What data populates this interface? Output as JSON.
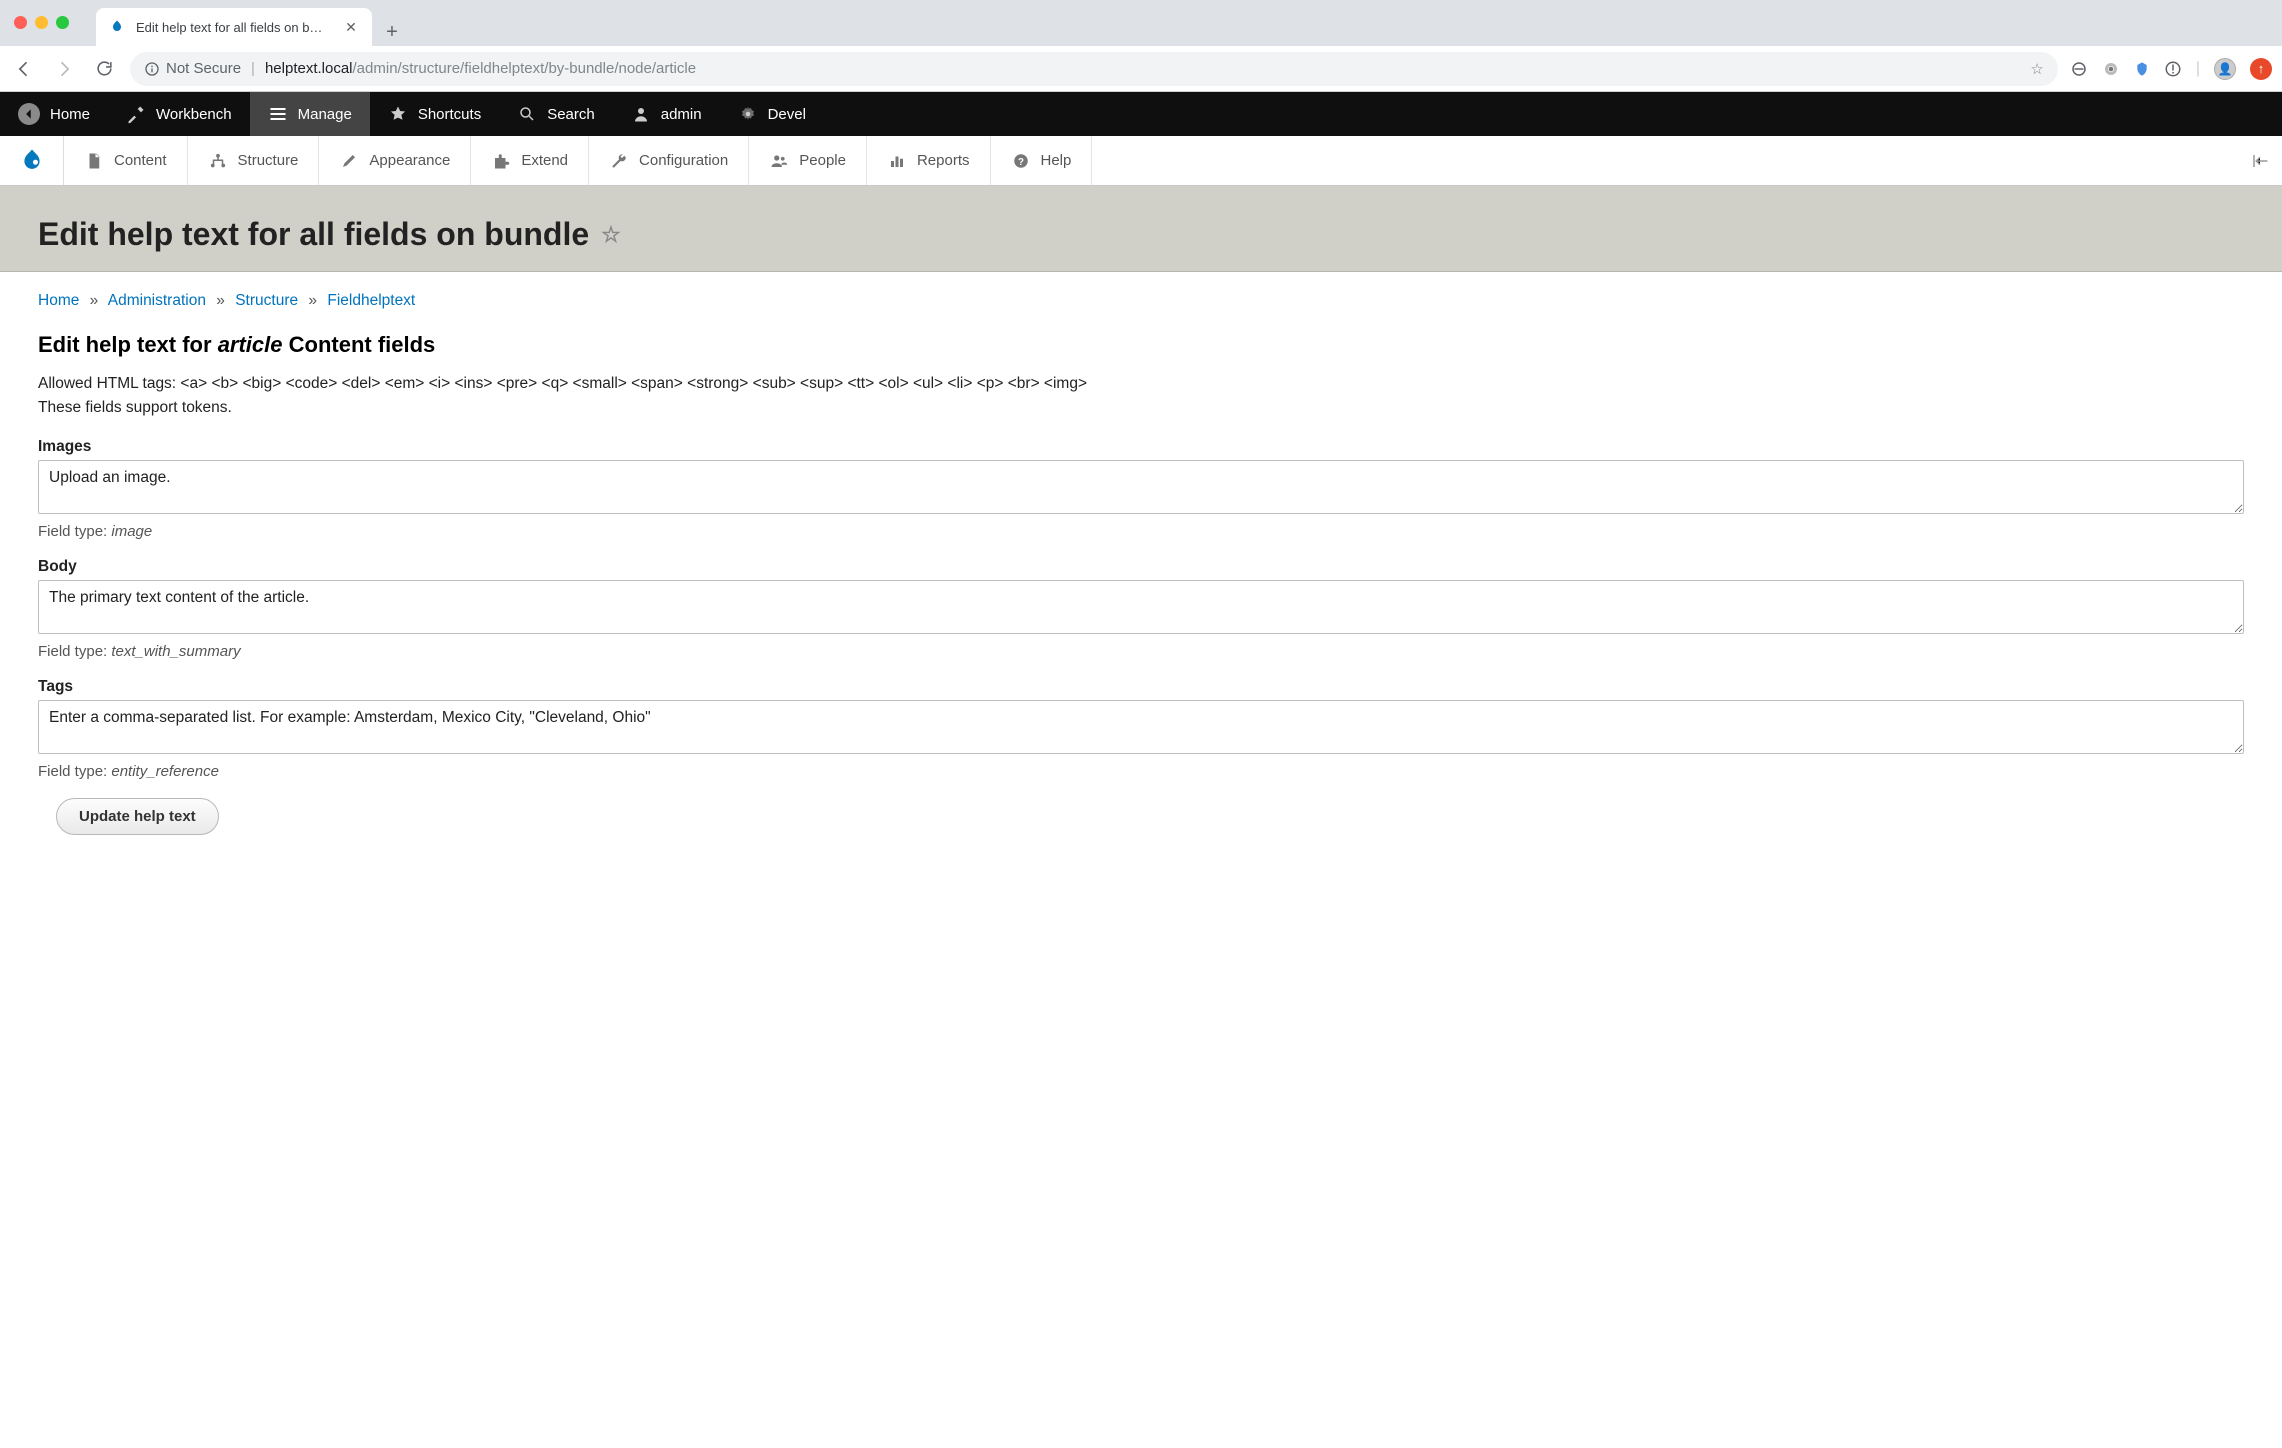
{
  "browser": {
    "tab_title": "Edit help text for all fields on b…",
    "url_secure_label": "Not Secure",
    "url_host": "helptext.local",
    "url_path": "/admin/structure/fieldhelptext/by-bundle/node/article"
  },
  "drupal_toolbar": {
    "home": "Home",
    "workbench": "Workbench",
    "manage": "Manage",
    "shortcuts": "Shortcuts",
    "search": "Search",
    "user": "admin",
    "devel": "Devel"
  },
  "admin_menu": {
    "content": "Content",
    "structure": "Structure",
    "appearance": "Appearance",
    "extend": "Extend",
    "configuration": "Configuration",
    "people": "People",
    "reports": "Reports",
    "help": "Help"
  },
  "page": {
    "title": "Edit help text for all fields on bundle",
    "breadcrumb": {
      "home": "Home",
      "administration": "Administration",
      "structure": "Structure",
      "fieldhelptext": "Fieldhelptext"
    },
    "subtitle_prefix": "Edit help text for ",
    "subtitle_bundle": "article",
    "subtitle_suffix": " Content fields",
    "allowed_tags": "Allowed HTML tags: <a> <b> <big> <code> <del> <em> <i> <ins> <pre> <q> <small> <span> <strong> <sub> <sup> <tt> <ol> <ul> <li> <p> <br> <img>",
    "tokens_note": "These fields support tokens."
  },
  "fields": [
    {
      "label": "Images",
      "value": "Upload an image.",
      "type_label": "Field type: ",
      "type": "image"
    },
    {
      "label": "Body",
      "value": "The primary text content of the article.",
      "type_label": "Field type: ",
      "type": "text_with_summary"
    },
    {
      "label": "Tags",
      "value": "Enter a comma-separated list. For example: Amsterdam, Mexico City, \"Cleveland, Ohio\"",
      "type_label": "Field type: ",
      "type": "entity_reference"
    }
  ],
  "actions": {
    "submit": "Update help text"
  }
}
